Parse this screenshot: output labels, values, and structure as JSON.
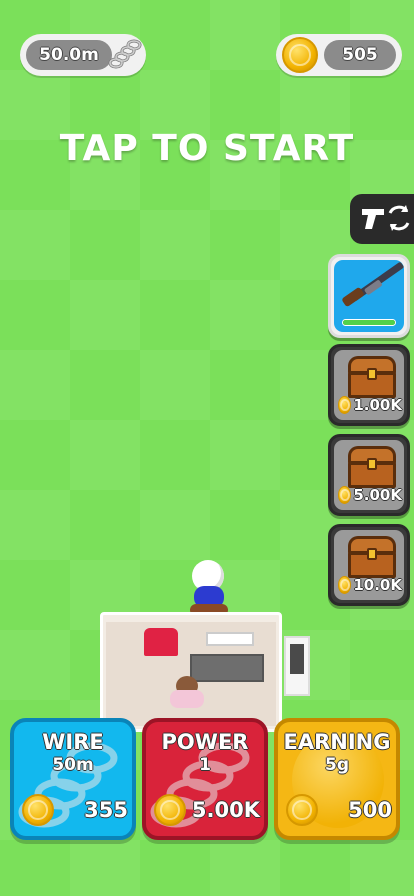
{
  "hud": {
    "wire_length": "50.0m",
    "coins": "505"
  },
  "prompt": "TAP TO START",
  "side": {
    "weapon_switch_icon": "gun-swap-icon",
    "weapon_icon": "shotgun-icon",
    "chests": [
      {
        "price": "1.00K"
      },
      {
        "price": "5.00K"
      },
      {
        "price": "10.0K"
      }
    ]
  },
  "upgrades": [
    {
      "title": "WIRE",
      "level": "50m",
      "cost": "355",
      "color": "#12b8ee"
    },
    {
      "title": "POWER",
      "level": "1",
      "cost": "5.00K",
      "color": "#d9233a"
    },
    {
      "title": "EARNING",
      "level": "5g",
      "cost": "500",
      "color": "#f5b714"
    }
  ]
}
